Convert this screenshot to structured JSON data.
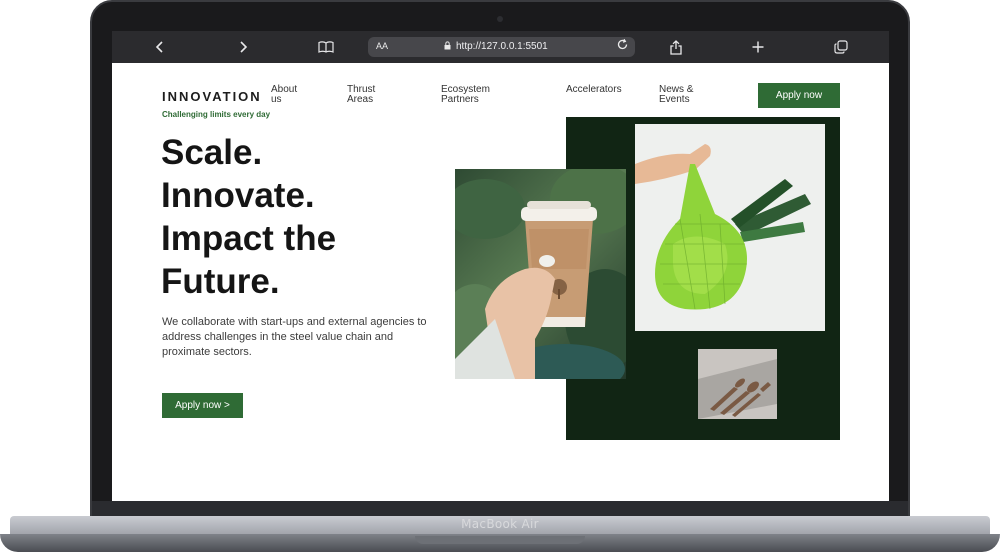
{
  "device": {
    "model_label": "MacBook Air"
  },
  "browser": {
    "text_size_label": "AA",
    "url": "http://127.0.0.1:5501",
    "icons": {
      "back": "chevron-left-icon",
      "forward": "chevron-right-icon",
      "bookmarks": "book-icon",
      "lock": "lock-icon",
      "reload": "reload-icon",
      "share": "share-icon",
      "new_tab": "plus-icon",
      "tabs": "tabs-icon"
    }
  },
  "nav": {
    "logo": "INNOVATION",
    "items": [
      {
        "line1": "About",
        "line2": "us"
      },
      {
        "line1": "Thrust",
        "line2": "Areas"
      },
      {
        "line1": "Ecosystem",
        "line2": "Partners"
      },
      {
        "line1": "Accelerators",
        "line2": ""
      },
      {
        "line1": "News &",
        "line2": "Events"
      }
    ],
    "apply_label": "Apply now"
  },
  "hero": {
    "tagline": "Challenging limits every day",
    "headline_lines": [
      "Scale.",
      "Innovate.",
      "Impact the",
      "Future."
    ],
    "description": "We collaborate with start-ups and external agencies to address challenges in the steel value chain and proximate sectors.",
    "cta_label": "Apply now >"
  },
  "colors": {
    "brand_green": "#2f6b35",
    "panel_dark_green": "#112514"
  }
}
